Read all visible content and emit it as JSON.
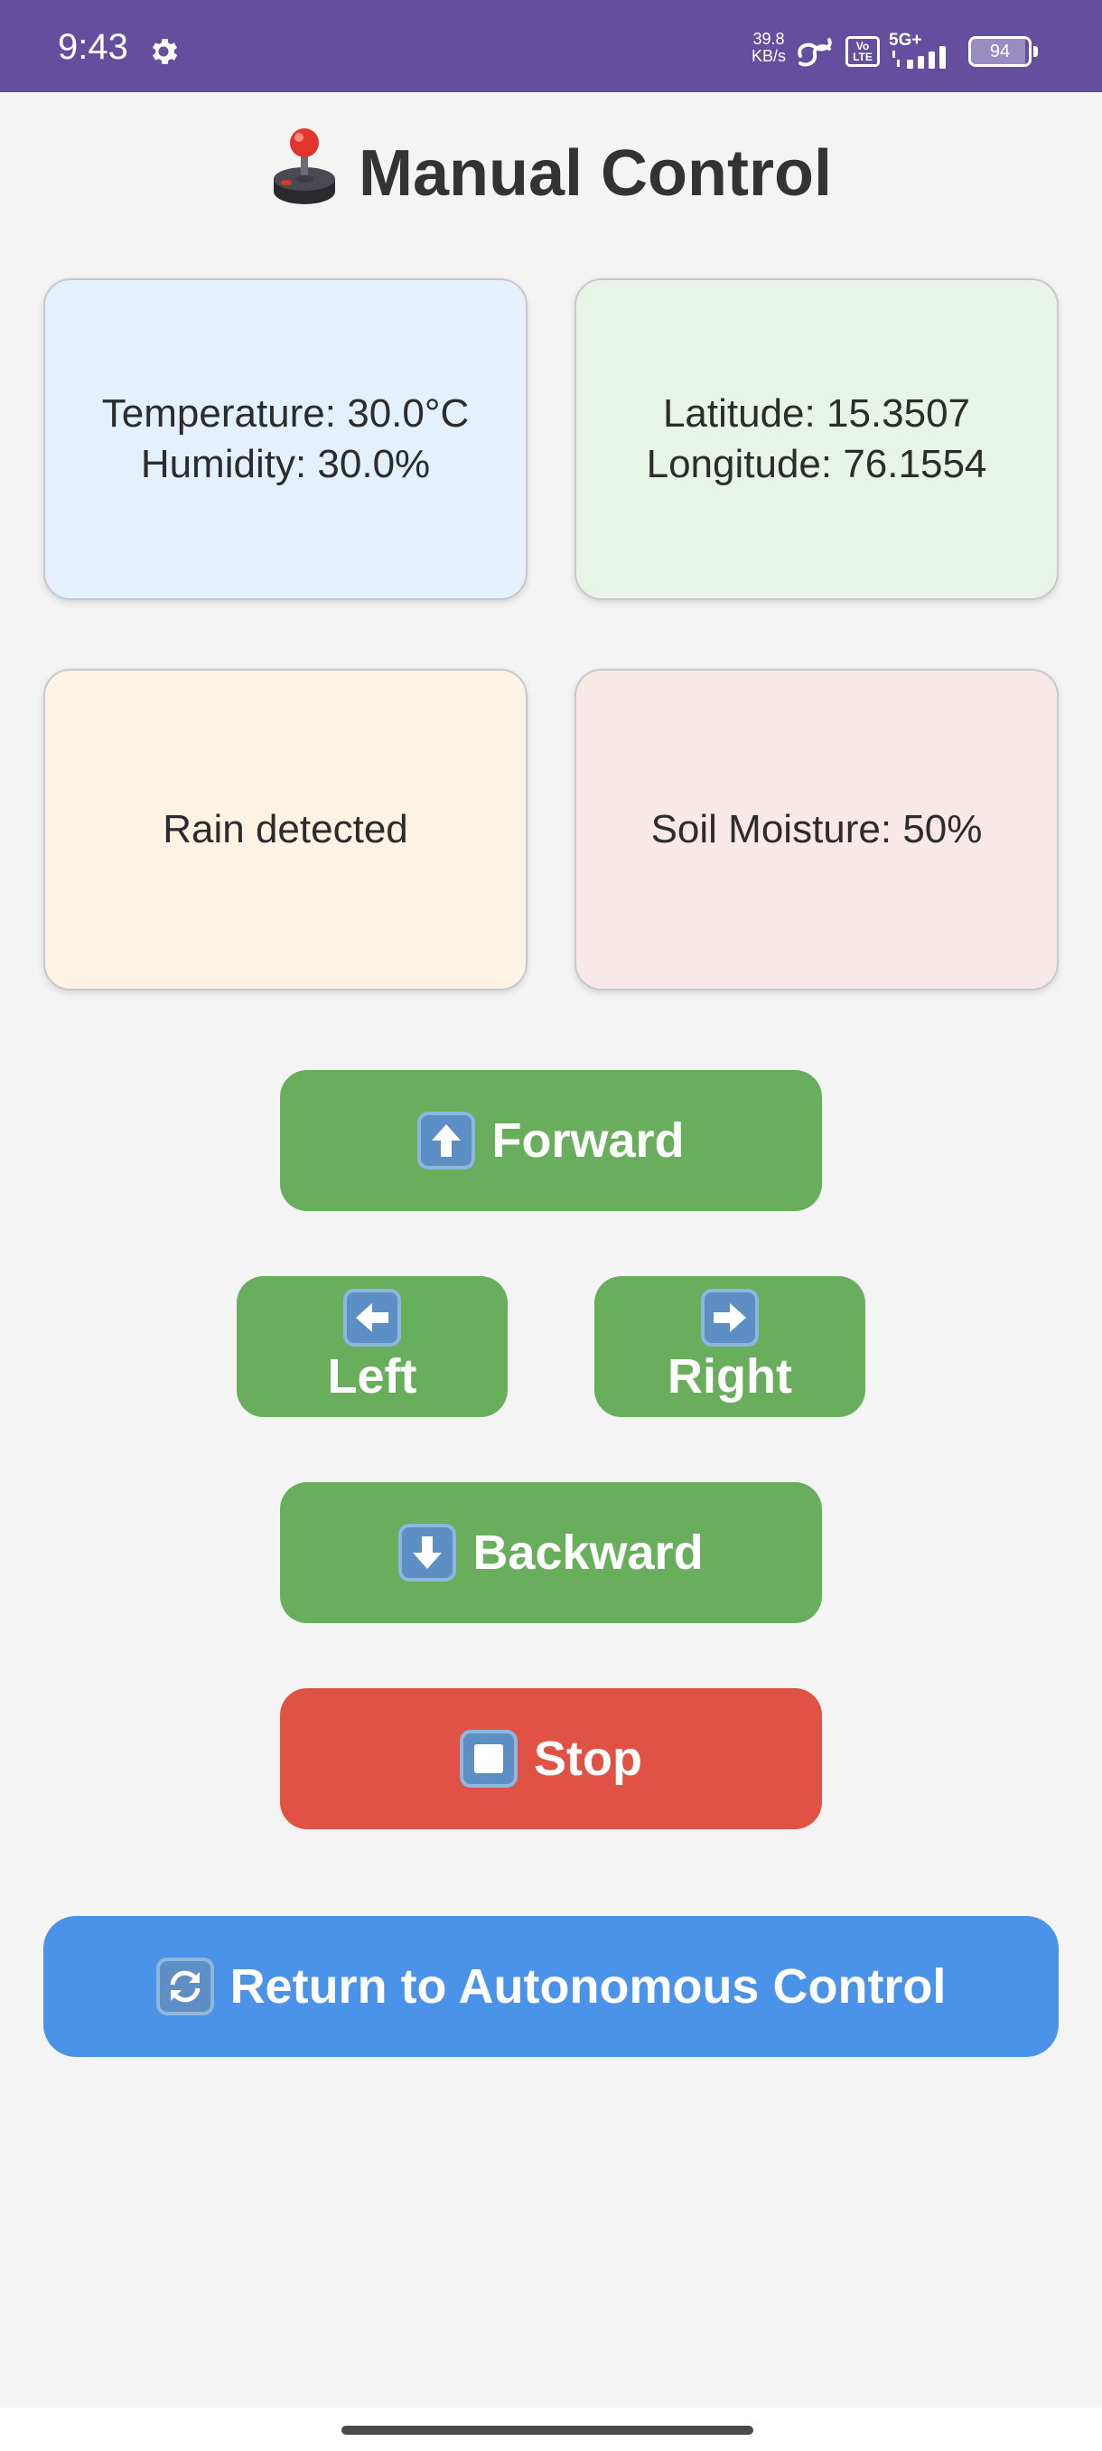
{
  "status_bar": {
    "time": "9:43",
    "net_speed_value": "39.8",
    "net_speed_unit": "KB/s",
    "volte_label": "Vo LTE",
    "network_type": "5G+",
    "battery_level": "94",
    "battery_fraction": 0.94,
    "background_color": "#634f9e"
  },
  "header": {
    "title": "Manual Control",
    "icon": "joystick-icon"
  },
  "cards": {
    "weather": {
      "temperature": "Temperature: 30.0°C",
      "humidity": "Humidity: 30.0%",
      "color": "#e4f1fc"
    },
    "gps": {
      "latitude": "Latitude: 15.3507",
      "longitude": "Longitude: 76.1554",
      "color": "#e7f4e7"
    },
    "rain": {
      "status": "Rain detected",
      "color": "#fcf3e4"
    },
    "soil": {
      "moisture": "Soil Moisture: 50%",
      "color": "#f8e9e8"
    }
  },
  "controls": {
    "forward": {
      "label": "Forward",
      "icon": "arrow-up-icon"
    },
    "left": {
      "label": "Left",
      "icon": "arrow-left-icon"
    },
    "right": {
      "label": "Right",
      "icon": "arrow-right-icon"
    },
    "backward": {
      "label": "Backward",
      "icon": "arrow-down-icon"
    },
    "stop": {
      "label": "Stop",
      "icon": "stop-icon"
    },
    "return": {
      "label": "Return to Autonomous Control",
      "icon": "refresh-icon"
    }
  },
  "colors": {
    "move_button": "#69ae5c",
    "stop_button": "#e05243",
    "return_button": "#4a93e9",
    "page_background": "#f4f4f4"
  }
}
